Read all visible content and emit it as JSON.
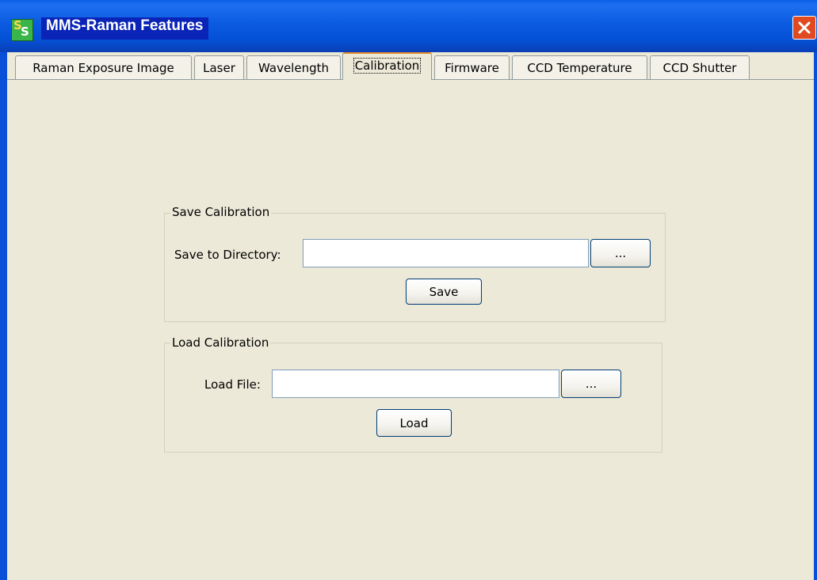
{
  "window": {
    "title": "MMS-Raman Features",
    "icon": "ss-app-icon",
    "close_icon": "close-icon"
  },
  "tabs": [
    {
      "label": "Raman Exposure Image",
      "active": false
    },
    {
      "label": "Laser",
      "active": false
    },
    {
      "label": "Wavelength",
      "active": false
    },
    {
      "label": "Calibration",
      "active": true
    },
    {
      "label": "Firmware",
      "active": false
    },
    {
      "label": "CCD Temperature",
      "active": false
    },
    {
      "label": "CCD Shutter",
      "active": false
    }
  ],
  "save_calibration": {
    "group_label": "Save Calibration",
    "directory_label": "Save to Directory:",
    "directory_value": "",
    "browse_label": "...",
    "save_label": "Save"
  },
  "load_calibration": {
    "group_label": "Load Calibration",
    "file_label": "Load File:",
    "file_value": "",
    "browse_label": "...",
    "load_label": "Load"
  },
  "colors": {
    "titlebar": "#0A5FE6",
    "background": "#ECE9D8",
    "active_tab_accent": "#E68B2C",
    "close_button": "#E04A20"
  }
}
